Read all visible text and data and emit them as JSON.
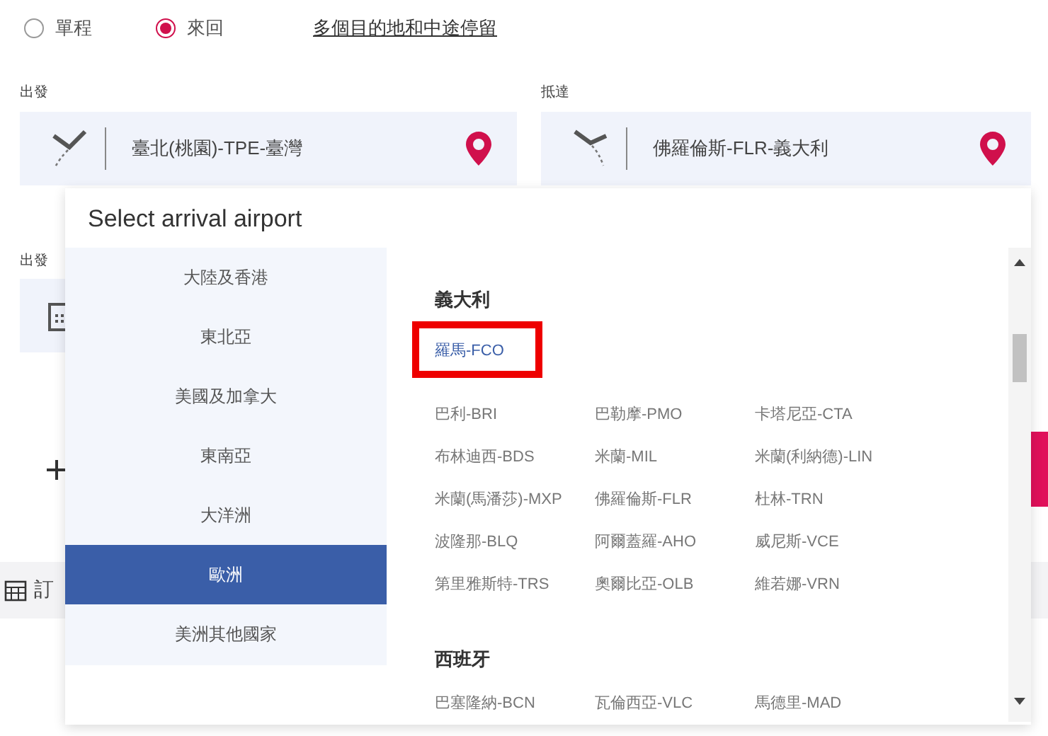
{
  "trip_types": [
    {
      "label": "單程",
      "selected": false
    },
    {
      "label": "來回",
      "selected": true
    }
  ],
  "multi_city_link": "多個目的地和中途停留",
  "origin": {
    "label": "出發",
    "value": "臺北(桃園)-TPE-臺灣"
  },
  "destination": {
    "label": "抵達",
    "value": "佛羅倫斯-FLR-義大利"
  },
  "date": {
    "label": "出發"
  },
  "section_text": "訂",
  "popup": {
    "title": "Select arrival airport",
    "regions": [
      {
        "label": "大陸及香港",
        "selected": false
      },
      {
        "label": "東北亞",
        "selected": false
      },
      {
        "label": "美國及加拿大",
        "selected": false
      },
      {
        "label": "東南亞",
        "selected": false
      },
      {
        "label": "大洋洲",
        "selected": false
      },
      {
        "label": "歐洲",
        "selected": true
      },
      {
        "label": "美洲其他國家",
        "selected": false
      }
    ],
    "countries": [
      {
        "name": "義大利",
        "featured": [
          {
            "label": "羅馬-FCO",
            "highlighted": true
          }
        ],
        "airports": [
          "巴利-BRI",
          "巴勒摩-PMO",
          "卡塔尼亞-CTA",
          "布林迪西-BDS",
          "米蘭-MIL",
          "米蘭(利納德)-LIN",
          "米蘭(馬潘莎)-MXP",
          "佛羅倫斯-FLR",
          "杜林-TRN",
          "波隆那-BLQ",
          "阿爾蓋羅-AHO",
          "威尼斯-VCE",
          "第里雅斯特-TRS",
          "奧爾比亞-OLB",
          "維若娜-VRN"
        ]
      },
      {
        "name": "西班牙",
        "airports": [
          "巴塞隆納-BCN",
          "瓦倫西亞-VLC",
          "馬德里-MAD"
        ]
      }
    ]
  }
}
